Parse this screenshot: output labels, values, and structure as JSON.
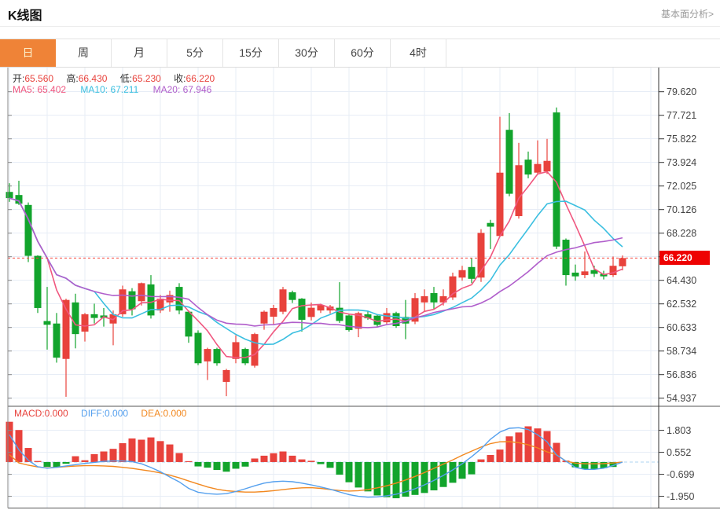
{
  "header": {
    "title": "K线图",
    "link": "基本面分析>"
  },
  "tabs": {
    "items": [
      "日",
      "周",
      "月",
      "5分",
      "15分",
      "30分",
      "60分",
      "4时"
    ],
    "active_index": 0
  },
  "overlay": {
    "ohlc": [
      {
        "label": "开:",
        "value": "65.560"
      },
      {
        "label": "高:",
        "value": "66.430"
      },
      {
        "label": "低:",
        "value": "65.230"
      },
      {
        "label": "收:",
        "value": "66.220"
      }
    ],
    "ma": [
      {
        "label": "MA5:",
        "value": "65.402"
      },
      {
        "label": "MA10:",
        "value": "67.211"
      },
      {
        "label": "MA20:",
        "value": "67.946"
      }
    ]
  },
  "macd_header": [
    {
      "label": "MACD:",
      "value": "0.000"
    },
    {
      "label": "DIFF:",
      "value": "0.000"
    },
    {
      "label": "DEA:",
      "value": "0.000"
    }
  ],
  "price_marker": {
    "value": "66.220"
  },
  "colors": {
    "up": "#e8423c",
    "down": "#12a42c",
    "ma5": "#f0577f",
    "ma10": "#3bbfe0",
    "ma20": "#b05ecb",
    "diff": "#55a0ee",
    "dea": "#f2881f",
    "grid": "#e7edf6",
    "zero_dash": "#aed3f0",
    "price_line": "#f5443b",
    "price_tag_bg": "#ee0202",
    "axis_text": "#444444",
    "axis_line": "#333333",
    "left_axis_line": "#888888",
    "panel_border": "#555555",
    "top_border": "#dcdcdc",
    "tab_active_bg": "#ef8337",
    "tab_active_text": "#fdf3cf"
  },
  "chart_data": {
    "type": "candlestick",
    "title": "K线图 日K (daily candlestick with MA5/MA10/MA20 and MACD)",
    "y_axis_labels": [
      "79.620",
      "77.721",
      "75.822",
      "73.924",
      "72.025",
      "70.126",
      "68.228",
      "",
      "64.430",
      "62.532",
      "60.633",
      "58.734",
      "56.836",
      "54.937"
    ],
    "y_range": [
      54.937,
      79.62
    ],
    "macd_axis_labels": [
      "1.803",
      "0.552",
      "-0.699",
      "-1.950"
    ],
    "macd_range": [
      -1.95,
      1.803
    ],
    "current_price": 66.22,
    "ma_periods": [
      5,
      10,
      20
    ],
    "grid": true,
    "candles_ohlc_format": [
      "open",
      "high",
      "low",
      "close"
    ],
    "candles": [
      [
        71.55,
        72.25,
        70.75,
        71.05
      ],
      [
        71.3,
        72.45,
        70.5,
        70.6
      ],
      [
        70.5,
        70.7,
        65.9,
        66.4
      ],
      [
        66.4,
        66.45,
        61.8,
        62.2
      ],
      [
        61.15,
        63.9,
        58.85,
        60.85
      ],
      [
        60.95,
        61.8,
        57.8,
        58.2
      ],
      [
        58.1,
        62.95,
        55.05,
        62.85
      ],
      [
        62.65,
        63.35,
        58.95,
        60.1
      ],
      [
        60.3,
        61.8,
        59.5,
        61.7
      ],
      [
        61.7,
        62.55,
        60.95,
        61.4
      ],
      [
        61.6,
        62.2,
        60.7,
        61.4
      ],
      [
        60.95,
        62.0,
        59.2,
        61.7
      ],
      [
        61.7,
        64.0,
        61.5,
        63.7
      ],
      [
        63.55,
        63.8,
        61.6,
        62.1
      ],
      [
        62.75,
        64.25,
        62.4,
        64.2
      ],
      [
        64.1,
        64.85,
        61.35,
        61.6
      ],
      [
        62.0,
        63.25,
        61.8,
        62.95
      ],
      [
        62.65,
        63.6,
        61.9,
        63.25
      ],
      [
        63.9,
        64.2,
        61.7,
        62.0
      ],
      [
        61.9,
        62.0,
        59.4,
        59.9
      ],
      [
        60.2,
        60.4,
        57.6,
        57.75
      ],
      [
        57.9,
        59.0,
        56.4,
        58.9
      ],
      [
        58.9,
        59.0,
        57.55,
        57.75
      ],
      [
        56.25,
        57.3,
        55.1,
        57.2
      ],
      [
        58.1,
        60.0,
        57.75,
        59.45
      ],
      [
        58.9,
        59.0,
        57.6,
        57.75
      ],
      [
        57.55,
        60.2,
        57.4,
        60.1
      ],
      [
        60.95,
        62.0,
        60.45,
        61.9
      ],
      [
        61.5,
        62.45,
        60.85,
        62.2
      ],
      [
        61.9,
        63.9,
        61.7,
        63.7
      ],
      [
        63.47,
        63.6,
        62.6,
        62.85
      ],
      [
        62.95,
        63.0,
        60.3,
        61.25
      ],
      [
        61.48,
        62.64,
        61.2,
        62.22
      ],
      [
        62.0,
        62.55,
        61.8,
        62.43
      ],
      [
        62.0,
        62.45,
        61.75,
        62.32
      ],
      [
        62.22,
        64.28,
        61.0,
        61.16
      ],
      [
        61.6,
        61.7,
        60.3,
        60.42
      ],
      [
        60.53,
        61.9,
        59.85,
        61.79
      ],
      [
        61.69,
        61.95,
        61.25,
        61.37
      ],
      [
        61.58,
        61.7,
        60.7,
        60.84
      ],
      [
        61.05,
        62.2,
        60.9,
        61.79
      ],
      [
        61.79,
        61.9,
        60.6,
        60.74
      ],
      [
        61.48,
        62.85,
        59.69,
        60.95
      ],
      [
        61.1,
        63.4,
        60.9,
        63.0
      ],
      [
        62.65,
        63.7,
        61.9,
        63.15
      ],
      [
        63.4,
        63.9,
        62.1,
        62.65
      ],
      [
        62.65,
        63.7,
        62.4,
        63.15
      ],
      [
        63.05,
        65.05,
        62.85,
        64.75
      ],
      [
        64.65,
        65.6,
        64.4,
        65.25
      ],
      [
        65.5,
        66.22,
        64.2,
        64.55
      ],
      [
        64.65,
        68.55,
        64.3,
        68.25
      ],
      [
        69.05,
        69.3,
        66.95,
        68.75
      ],
      [
        68.0,
        77.6,
        67.9,
        73.1
      ],
      [
        76.55,
        77.9,
        71.2,
        71.4
      ],
      [
        69.6,
        75.5,
        69.4,
        73.7
      ],
      [
        74.15,
        74.8,
        72.65,
        72.95
      ],
      [
        73.1,
        75.7,
        73.0,
        73.8
      ],
      [
        73.2,
        75.82,
        73.0,
        74.05
      ],
      [
        77.95,
        78.35,
        66.95,
        67.15
      ],
      [
        67.7,
        67.8,
        64.0,
        64.85
      ],
      [
        65.05,
        65.7,
        64.4,
        64.75
      ],
      [
        64.85,
        66.75,
        64.6,
        65.15
      ],
      [
        65.25,
        65.6,
        64.7,
        64.95
      ],
      [
        64.95,
        65.2,
        64.5,
        64.75
      ],
      [
        64.85,
        66.35,
        64.7,
        65.6
      ],
      [
        65.56,
        66.43,
        65.23,
        66.22
      ]
    ],
    "macd": {
      "hist": [
        2.29,
        1.82,
        0.8,
        0.06,
        -0.27,
        -0.3,
        -0.1,
        0.33,
        0.1,
        0.45,
        0.6,
        0.75,
        1.07,
        1.34,
        1.27,
        1.4,
        1.19,
        1.0,
        0.51,
        0.05,
        -0.25,
        -0.32,
        -0.45,
        -0.55,
        -0.38,
        -0.26,
        0.2,
        0.36,
        0.5,
        0.6,
        0.36,
        0.15,
        0.07,
        -0.12,
        -0.33,
        -0.72,
        -1.15,
        -1.45,
        -1.67,
        -1.9,
        -2.0,
        -2.06,
        -1.97,
        -1.87,
        -1.76,
        -1.61,
        -1.42,
        -1.18,
        -0.95,
        -0.7,
        0.15,
        0.4,
        0.71,
        1.46,
        1.68,
        2.03,
        1.91,
        1.76,
        1.09,
        0.08,
        -0.3,
        -0.4,
        -0.4,
        -0.35,
        -0.28,
        0.0
      ],
      "diff": [
        1.55,
        0.7,
        0.1,
        -0.27,
        -0.35,
        -0.3,
        -0.22,
        -0.15,
        -0.08,
        -0.02,
        0.04,
        0.06,
        0.06,
        0.02,
        -0.1,
        -0.31,
        -0.55,
        -0.85,
        -1.13,
        -1.5,
        -1.72,
        -1.8,
        -1.83,
        -1.8,
        -1.68,
        -1.52,
        -1.35,
        -1.2,
        -1.12,
        -1.09,
        -1.12,
        -1.2,
        -1.3,
        -1.42,
        -1.55,
        -1.7,
        -1.85,
        -1.95,
        -2.0,
        -1.98,
        -1.92,
        -1.83,
        -1.7,
        -1.52,
        -1.3,
        -1.05,
        -0.76,
        -0.45,
        -0.1,
        0.3,
        0.75,
        1.3,
        1.7,
        1.92,
        1.95,
        1.85,
        1.55,
        1.15,
        0.4,
        0.05,
        -0.3,
        -0.42,
        -0.42,
        -0.35,
        -0.2,
        0.0
      ],
      "dea": [
        0.42,
        -0.05,
        -0.18,
        -0.28,
        -0.33,
        -0.3,
        -0.26,
        -0.23,
        -0.21,
        -0.21,
        -0.22,
        -0.25,
        -0.3,
        -0.36,
        -0.44,
        -0.52,
        -0.62,
        -0.75,
        -0.9,
        -1.08,
        -1.25,
        -1.42,
        -1.55,
        -1.63,
        -1.68,
        -1.71,
        -1.71,
        -1.68,
        -1.63,
        -1.57,
        -1.51,
        -1.47,
        -1.46,
        -1.5,
        -1.56,
        -1.62,
        -1.65,
        -1.63,
        -1.57,
        -1.47,
        -1.35,
        -1.2,
        -1.02,
        -0.82,
        -0.6,
        -0.36,
        -0.12,
        0.12,
        0.38,
        0.62,
        0.85,
        1.05,
        1.15,
        1.16,
        1.1,
        0.98,
        0.8,
        0.58,
        0.42,
        0.05,
        -0.06,
        -0.1,
        -0.1,
        -0.09,
        -0.05,
        0.0
      ]
    }
  }
}
